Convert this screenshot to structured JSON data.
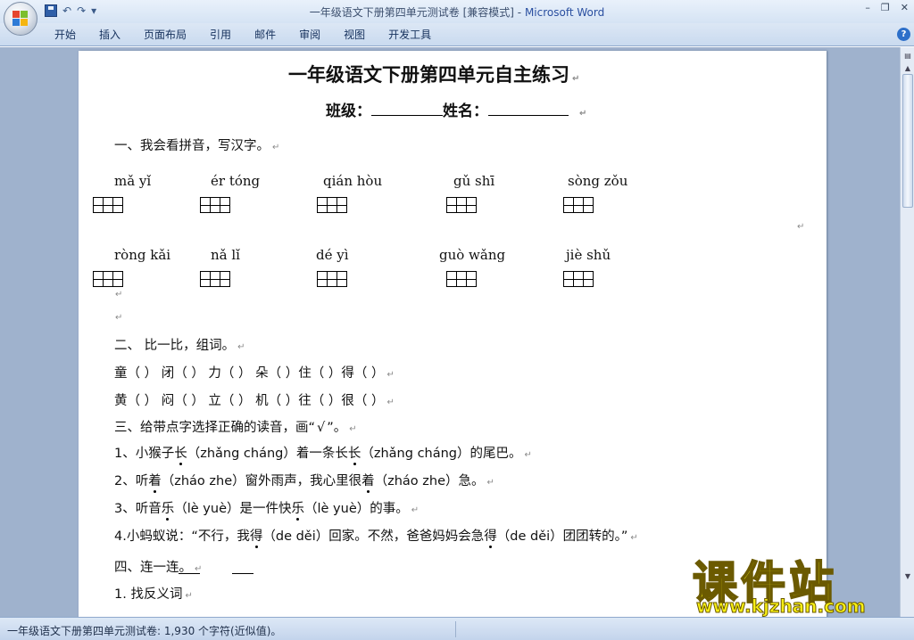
{
  "window": {
    "title_doc": "一年级语文下册第四单元测试卷 [兼容模式]",
    "title_sep": " - ",
    "title_app": "Microsoft Word"
  },
  "qat": {
    "undo": "↶",
    "redo": "↷",
    "customize": "▾"
  },
  "win_controls": {
    "minimize": "–",
    "restore": "❐",
    "close": "✕"
  },
  "ribbon": {
    "tabs": [
      "开始",
      "插入",
      "页面布局",
      "引用",
      "邮件",
      "审阅",
      "视图",
      "开发工具"
    ],
    "help": "?"
  },
  "doc": {
    "title": "一年级语文下册第四单元自主练习",
    "class_label": "班级：",
    "name_label": "姓名：",
    "s1": "一、我会看拼音，写汉字。",
    "py_row1": [
      "mǎ  yǐ",
      "ér  tóng",
      "qián  hòu",
      "gǔ   shī",
      "sòng  zǒu"
    ],
    "py_row2": [
      "ròng kǎi",
      "nǎ  lǐ",
      "dé   yì",
      "guò  wǎng",
      "jiè  shǔ"
    ],
    "s2": "二、 比一比，组词。",
    "compare_row1": "童（     ） 闭（     ） 力（     ） 朵（     ）住（     ）得（     ）",
    "compare_row2": "黄（     ） 闷（     ） 立（     ） 机（     ）往（     ）很（     ）",
    "s3_a": "三、给带点字选择正确的读音，画“",
    "s3_check": "√",
    "s3_b": "”。",
    "q1_a": "1、小猴子",
    "q1_dot": "长",
    "q1_b": "（zhǎng cháng）着一条长",
    "q1_c": "（zhǎng cháng）的尾巴。",
    "q2_a": "2、听",
    "q2_dot": "着",
    "q2_b": "（zháo  zhe）窗外雨声，我心里很",
    "q2_c": "（zháo  zhe）急。",
    "q3_a": "3、听音",
    "q3_dot": "乐",
    "q3_b": "（lè  yuè）是一件快",
    "q3_c": "（lè  yuè）的事。",
    "q4_a": "4.小蚂蚁说：“不行，我",
    "q4_dot": "得",
    "q4_b": "（de děi）回家。不然，爸爸妈妈会急",
    "q4_c": "（de děi）团团转的。”",
    "s4": "四、连一连。",
    "s4_1": "1.   找反义词"
  },
  "watermark": {
    "text": "课件站",
    "url": "www.kjzhan.com"
  },
  "status": {
    "text": "一年级语文下册第四单元测试卷: 1,930 个字符(近似值)。"
  }
}
